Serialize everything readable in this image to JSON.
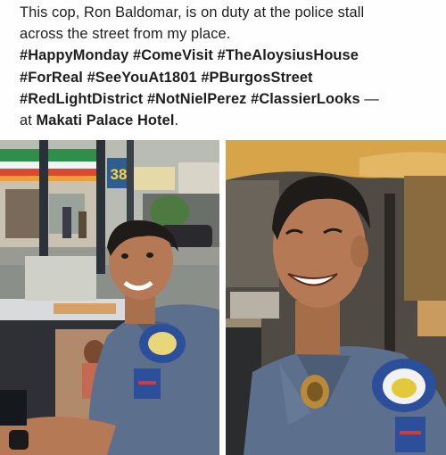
{
  "post": {
    "caption_lines": [
      "This cop, Ron Baldomar, is on duty at the police stall",
      "across the street from my place."
    ],
    "hashtag_lines": [
      "#HappyMonday #ComeVisit #TheAloysiusHouse",
      "#ForReal #SeeYouAt1801 #PBurgosStreet",
      "#RedLightDistrict #NotNielPerez #ClassierLooks"
    ],
    "hashtag_suffix": " —",
    "location_prefix": "at ",
    "location": "Makati Palace Hotel",
    "location_suffix": "."
  },
  "photos": {
    "left": {
      "subject": "police officer seated at stall, smiling",
      "store_sign": "38"
    },
    "right": {
      "subject": "police officer close-up, smiling"
    }
  },
  "colors": {
    "uniform": "#5c6f8c",
    "skin": "#b57a55",
    "hair": "#1f1b18",
    "awning": "#d7a44a"
  }
}
